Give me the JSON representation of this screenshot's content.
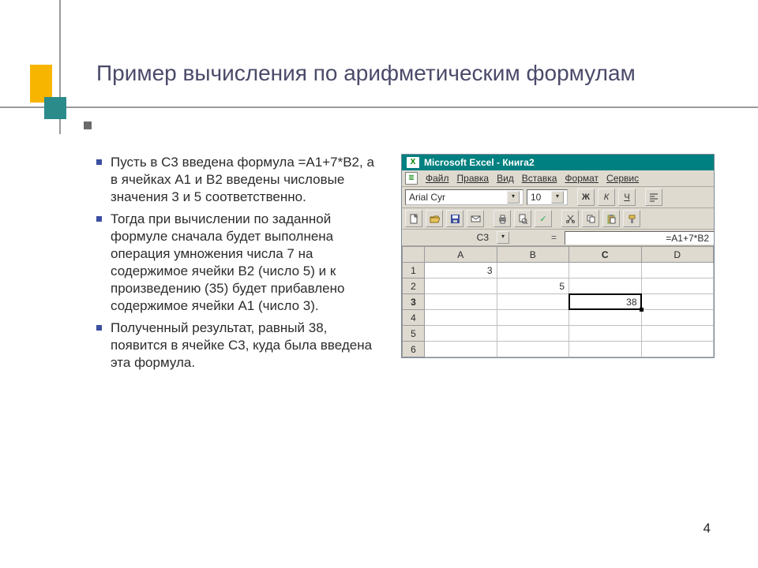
{
  "title": "Пример вычисления по арифметическим формулам",
  "bullets": {
    "b1": "Пусть в С3 введена формула =А1+7*В2, а в ячейках А1 и В2 введены числовые значения 3 и 5 соответственно.",
    "b2": "Тогда при вычислении по заданной формуле сначала будет выполнена операция умножения числа 7 на содержимое ячейки В2 (число 5) и к произведению (35) будет прибавлено содержимое ячейки А1 (число 3).",
    "b3": "Полученный результат, равный 38, появится в ячейке С3, куда была введена эта формула."
  },
  "page_number": "4",
  "excel": {
    "app_title": "Microsoft Excel - Книга2",
    "menus": {
      "file": "Файл",
      "edit": "Правка",
      "view": "Вид",
      "insert": "Вставка",
      "format": "Формат",
      "service": "Сервис"
    },
    "font_name": "Arial Cyr",
    "font_size": "10",
    "bold": "Ж",
    "italic": "К",
    "underline": "Ч",
    "name_box": "C3",
    "formula": "=A1+7*B2",
    "columns": {
      "A": "A",
      "B": "B",
      "C": "C",
      "D": "D"
    },
    "rows": {
      "r1": "1",
      "r2": "2",
      "r3": "3",
      "r4": "4",
      "r5": "5",
      "r6": "6"
    },
    "cells": {
      "A1": "3",
      "B2": "5",
      "C3": "38"
    }
  }
}
